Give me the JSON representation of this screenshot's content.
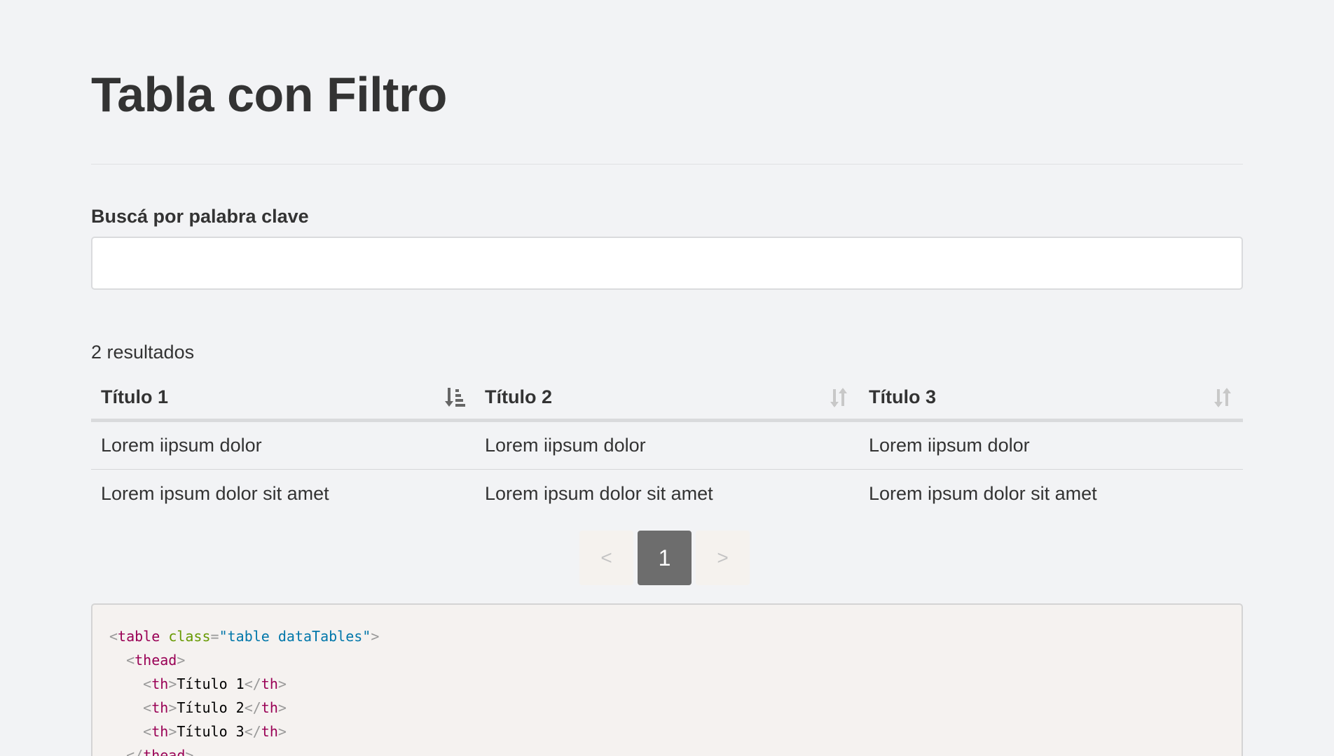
{
  "page": {
    "title": "Tabla con Filtro"
  },
  "search": {
    "label": "Buscá por palabra clave",
    "value": "",
    "placeholder": ""
  },
  "results": {
    "count_text": "2 resultados"
  },
  "table": {
    "columns": [
      {
        "label": "Título 1",
        "sort_icon": "sort-amount-down-icon",
        "sorted": true
      },
      {
        "label": "Título 2",
        "sort_icon": "sort-icon",
        "sorted": false
      },
      {
        "label": "Título 3",
        "sort_icon": "sort-icon",
        "sorted": false
      }
    ],
    "rows": [
      [
        "Lorem iipsum dolor",
        "Lorem iipsum dolor",
        "Lorem iipsum dolor"
      ],
      [
        "Lorem ipsum dolor sit amet",
        "Lorem ipsum dolor sit amet",
        "Lorem ipsum dolor sit amet"
      ]
    ]
  },
  "pagination": {
    "prev_label": "<",
    "current_page": "1",
    "next_label": ">"
  },
  "code": {
    "lines": [
      {
        "indent": "",
        "open": "<",
        "tag": "table",
        "attr": "class",
        "eq": "=",
        "q1": "\"",
        "val": "table dataTables",
        "q2": "\"",
        "close": ">"
      },
      {
        "indent": "  ",
        "open": "<",
        "tag": "thead",
        "close": ">"
      },
      {
        "indent": "    ",
        "open": "<",
        "tag": "th",
        "close": ">",
        "text": "Título 1",
        "end_open": "</",
        "end_tag": "th",
        "end_close": ">"
      },
      {
        "indent": "    ",
        "open": "<",
        "tag": "th",
        "close": ">",
        "text": "Título 2",
        "end_open": "</",
        "end_tag": "th",
        "end_close": ">"
      },
      {
        "indent": "    ",
        "open": "<",
        "tag": "th",
        "close": ">",
        "text": "Título 3",
        "end_open": "</",
        "end_tag": "th",
        "end_close": ">"
      },
      {
        "indent": "  ",
        "open": "</",
        "tag": "thead",
        "close": ">"
      }
    ]
  },
  "colors": {
    "background": "#f2f3f5",
    "text": "#333333",
    "pagination_active": "#6d6d6d",
    "code_background": "#f5f2f0",
    "code_tag": "#990055",
    "code_attr": "#669900",
    "code_value": "#0077aa"
  }
}
